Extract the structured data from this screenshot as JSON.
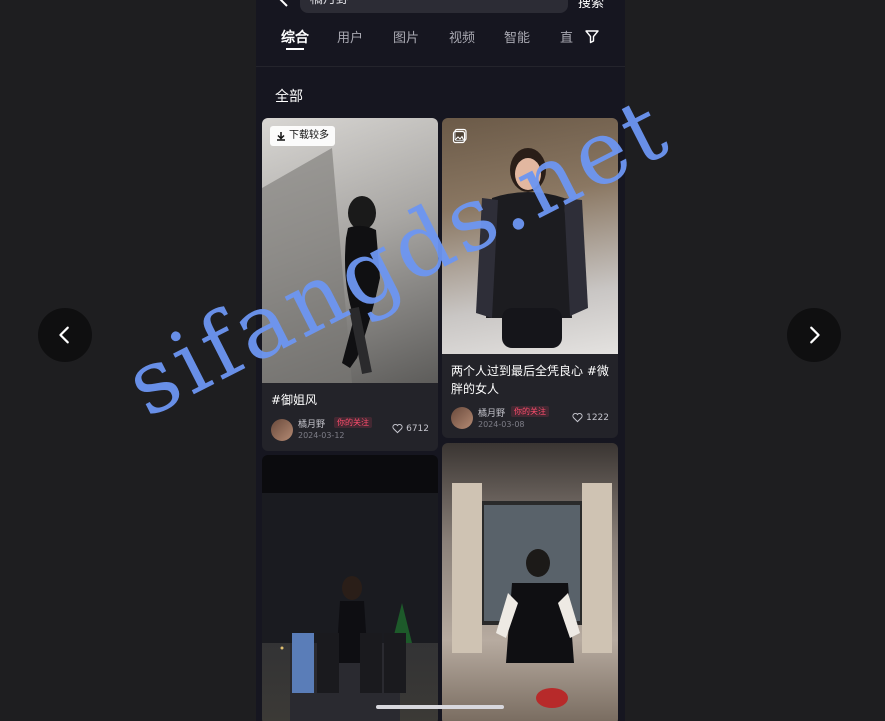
{
  "viewer": {
    "prev_icon": "chevron-left-icon",
    "next_icon": "chevron-right-icon"
  },
  "search": {
    "query": "橘月野",
    "submit_label": "搜索"
  },
  "tabs": [
    "综合",
    "用户",
    "图片",
    "视频",
    "智能",
    "直"
  ],
  "section_title": "全部",
  "cards": [
    {
      "badge": "下载较多",
      "caption": "#御姐风",
      "author": "橘月野",
      "follow_tag": "你的关注",
      "date": "2024-03-12",
      "likes": "6712"
    },
    {
      "caption": "两个人过到最后全凭良心 #微胖的女人",
      "author": "橘月野",
      "follow_tag": "你的关注",
      "date": "2024-03-08",
      "likes": "1222"
    },
    {},
    {}
  ],
  "watermark": "sifangds.net",
  "colors": {
    "background": "#1e1e20",
    "phone_bg": "#161620",
    "accent_follow": "#ff4d6d",
    "watermark": "#6d96f2"
  }
}
